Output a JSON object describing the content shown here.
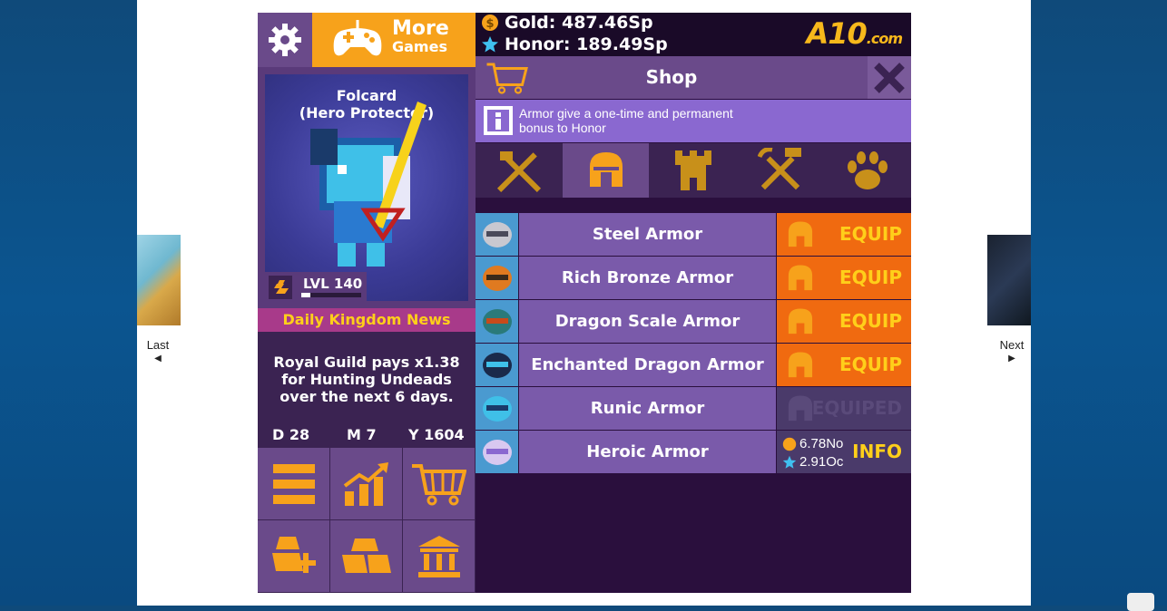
{
  "nav": {
    "last_label": "Last",
    "next_label": "Next",
    "last_arrow": "◀",
    "next_arrow": "▶"
  },
  "topbar": {
    "more_games_line1": "More",
    "more_games_line2": "Games",
    "gold_label": "Gold: 487.46Sp",
    "honor_label": "Honor: 189.49Sp",
    "logo_text": "A10",
    "logo_suffix": ".com"
  },
  "hero": {
    "name": "Folcard",
    "title": "(Hero Protector)",
    "level_label": "LVL 140",
    "level_progress": 0.15
  },
  "news": {
    "title": "Daily Kingdom News",
    "line1": "Royal Guild pays x1.38",
    "line2": "for Hunting Undeads",
    "line3": "over the next 6 days.",
    "day": "D 28",
    "month": "M 7",
    "year": "Y 1604"
  },
  "shop": {
    "title": "Shop",
    "info_line1": "Armor give a one-time and permanent",
    "info_line2": "bonus to Honor",
    "tabs": [
      "weapons-tab",
      "armor-tab",
      "castle-tab",
      "tools-tab",
      "pets-tab"
    ],
    "active_tab": 1,
    "items": [
      {
        "name": "Steel Armor",
        "action": "EQUIP",
        "state": "equip"
      },
      {
        "name": "Rich Bronze Armor",
        "action": "EQUIP",
        "state": "equip"
      },
      {
        "name": "Dragon Scale Armor",
        "action": "EQUIP",
        "state": "equip"
      },
      {
        "name": "Enchanted Dragon Armor",
        "action": "EQUIP",
        "state": "equip"
      },
      {
        "name": "Runic Armor",
        "action": "EQUIPED",
        "state": "equiped"
      },
      {
        "name": "Heroic Armor",
        "action": "INFO",
        "state": "price",
        "gold_price": "6.78No",
        "honor_price": "2.91Oc"
      }
    ]
  },
  "colors": {
    "accent": "#f7a21b",
    "equip": "#f06a10",
    "panel": "#6a4a8a",
    "bg": "#2a0f3d"
  }
}
